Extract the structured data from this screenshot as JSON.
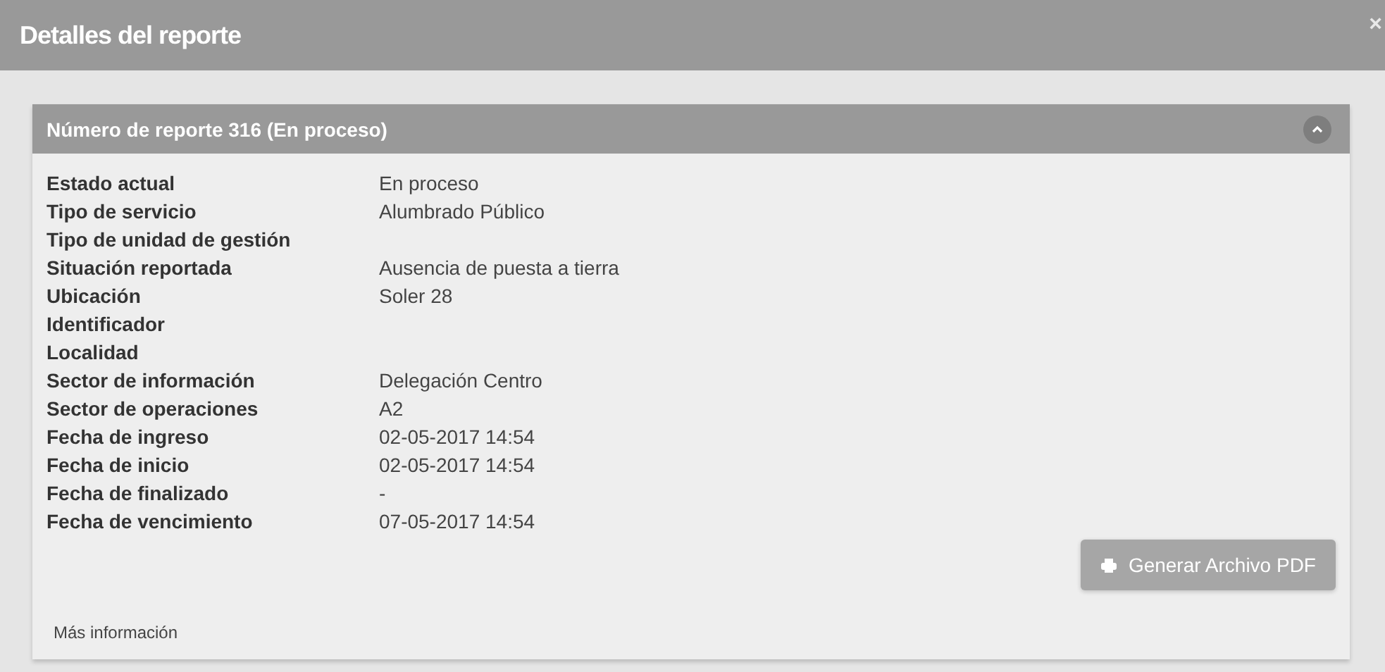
{
  "window": {
    "title": "Detalles del reporte",
    "close": "×"
  },
  "panel": {
    "title": "Número de reporte 316 (En proceso)",
    "expanded": true,
    "rows": [
      {
        "label": "Estado actual",
        "value": "En proceso"
      },
      {
        "label": "Tipo de servicio",
        "value": "Alumbrado Público"
      },
      {
        "label": "Tipo de unidad de gestión"
      },
      {
        "label": "Situación reportada",
        "value": "Ausencia de puesta a tierra"
      },
      {
        "label": "Ubicación",
        "value": "Soler 28"
      },
      {
        "label": "Identificador"
      },
      {
        "label": "Localidad"
      },
      {
        "label": "Sector de información",
        "value": "Delegación Centro"
      },
      {
        "label": "Sector de operaciones",
        "value": "A2"
      },
      {
        "label": "Fecha de ingreso",
        "value": "02-05-2017 14:54"
      },
      {
        "label": "Fecha de inicio",
        "value": "02-05-2017 14:54"
      },
      {
        "label": "Fecha de finalizado",
        "value": "-"
      },
      {
        "label": "Fecha de vencimiento",
        "value": "07-05-2017 14:54"
      }
    ],
    "button": "Generar Archivo PDF",
    "more_link": "Más información"
  }
}
